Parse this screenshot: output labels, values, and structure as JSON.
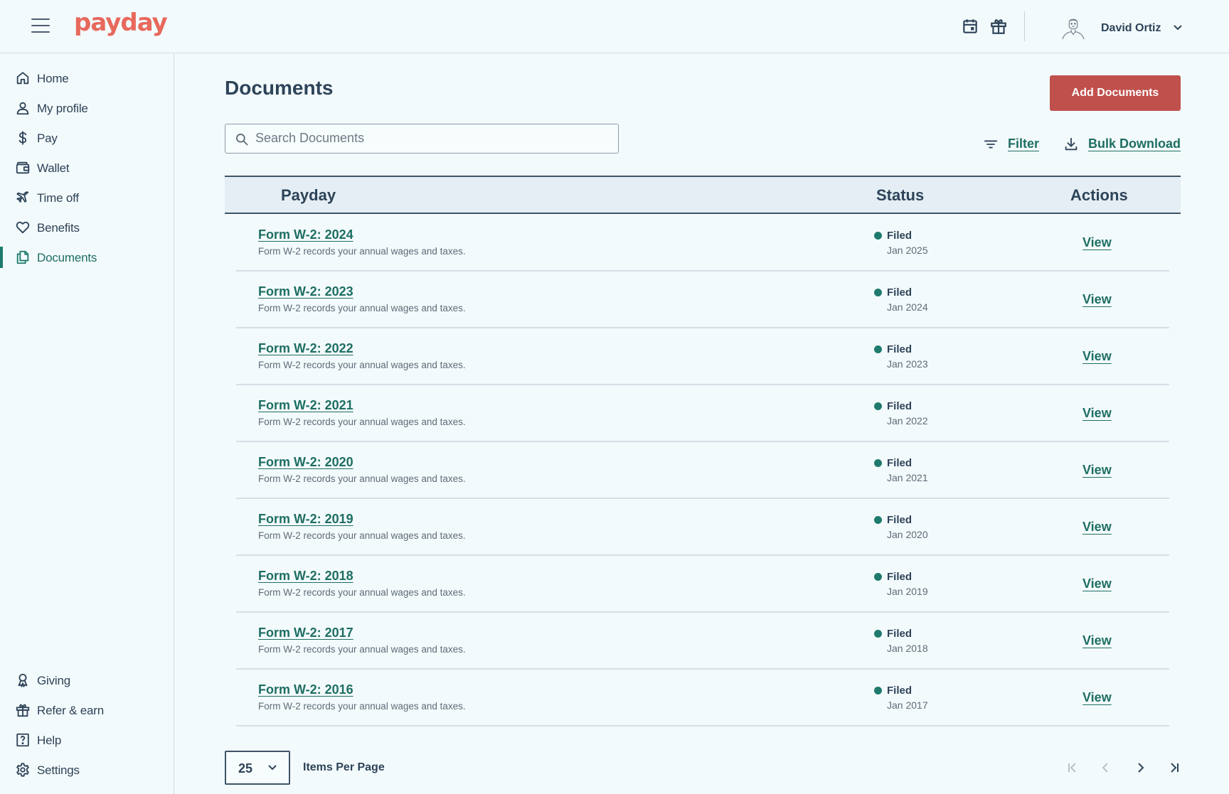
{
  "app": {
    "logo_text": "payday",
    "brand_color": "#e8685c",
    "accent_color": "#1e7a6c",
    "primary_button_color": "#c0504c"
  },
  "header": {
    "user_name": "David Ortiz",
    "icons": [
      "menu-icon",
      "calendar-icon",
      "gift-icon",
      "avatar",
      "chevron-down-icon"
    ]
  },
  "sidebar": {
    "items": [
      {
        "label": "Home",
        "icon": "home-icon"
      },
      {
        "label": "My profile",
        "icon": "user-icon"
      },
      {
        "label": "Pay",
        "icon": "dollar-icon"
      },
      {
        "label": "Wallet",
        "icon": "wallet-icon"
      },
      {
        "label": "Time off",
        "icon": "plane-icon"
      },
      {
        "label": "Benefits",
        "icon": "heart-icon"
      },
      {
        "label": "Documents",
        "icon": "documents-icon",
        "active": true
      }
    ],
    "bottom_items": [
      {
        "label": "Giving",
        "icon": "ribbon-icon"
      },
      {
        "label": "Refer & earn",
        "icon": "gift-icon"
      },
      {
        "label": "Help",
        "icon": "help-icon"
      },
      {
        "label": "Settings",
        "icon": "gear-icon"
      }
    ]
  },
  "main": {
    "title": "Documents",
    "add_button": "Add Documents",
    "search_placeholder": "Search Documents",
    "filter_label": "Filter",
    "bulk_download_label": "Bulk Download",
    "table": {
      "columns": [
        "Payday",
        "Status",
        "Actions"
      ],
      "rows": [
        {
          "title": "Form W-2: 2024",
          "description": "Form W-2 records your annual wages and taxes.",
          "status": "Filed",
          "date": "Jan 2025",
          "action": "View"
        },
        {
          "title": "Form W-2: 2023",
          "description": "Form W-2 records your annual wages and taxes.",
          "status": "Filed",
          "date": "Jan 2024",
          "action": "View"
        },
        {
          "title": "Form W-2: 2022",
          "description": "Form W-2 records your annual wages and taxes.",
          "status": "Filed",
          "date": "Jan 2023",
          "action": "View"
        },
        {
          "title": "Form W-2: 2021",
          "description": "Form W-2 records your annual wages and taxes.",
          "status": "Filed",
          "date": "Jan 2022",
          "action": "View"
        },
        {
          "title": "Form W-2: 2020",
          "description": "Form W-2 records your annual wages and taxes.",
          "status": "Filed",
          "date": "Jan 2021",
          "action": "View"
        },
        {
          "title": "Form W-2: 2019",
          "description": "Form W-2 records your annual wages and taxes.",
          "status": "Filed",
          "date": "Jan 2020",
          "action": "View"
        },
        {
          "title": "Form W-2: 2018",
          "description": "Form W-2 records your annual wages and taxes.",
          "status": "Filed",
          "date": "Jan 2019",
          "action": "View"
        },
        {
          "title": "Form W-2: 2017",
          "description": "Form W-2 records your annual wages and taxes.",
          "status": "Filed",
          "date": "Jan 2018",
          "action": "View"
        },
        {
          "title": "Form W-2: 2016",
          "description": "Form W-2 records your annual wages and taxes.",
          "status": "Filed",
          "date": "Jan 2017",
          "action": "View"
        }
      ]
    },
    "pagination": {
      "per_page": "25",
      "per_page_label": "Items Per Page"
    }
  }
}
